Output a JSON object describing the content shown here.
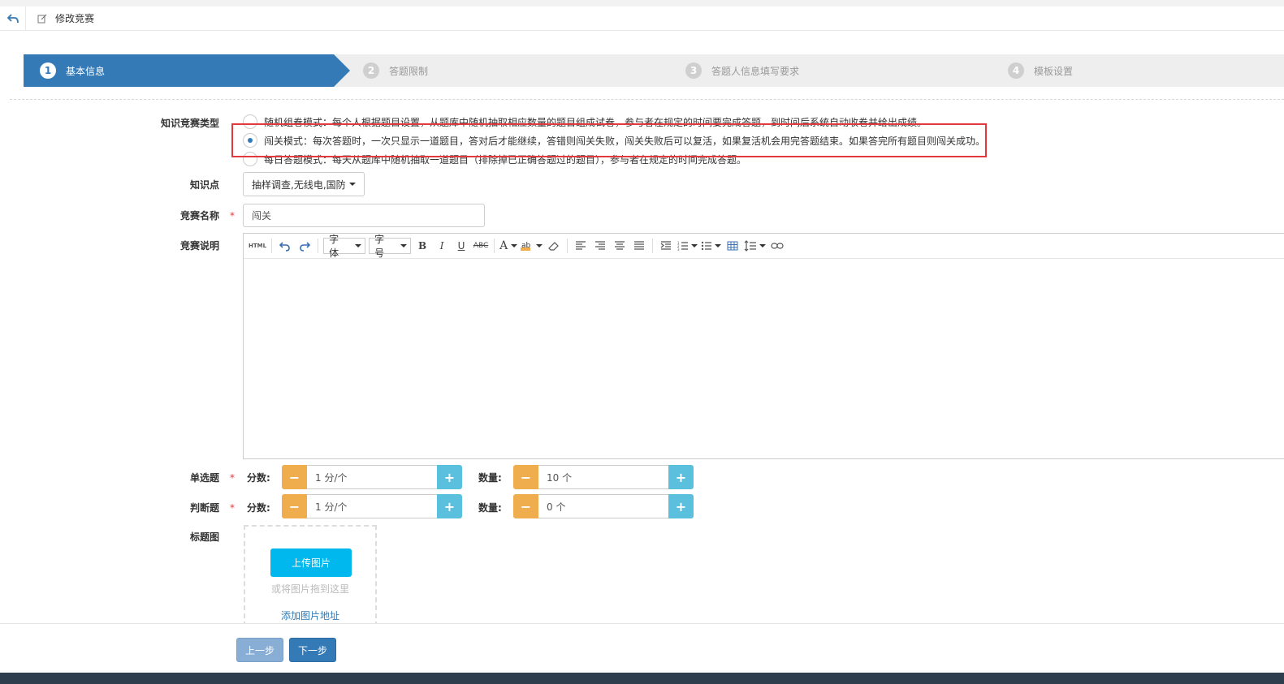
{
  "header": {
    "title": "修改竞赛"
  },
  "steps": [
    {
      "num": "1",
      "label": "基本信息"
    },
    {
      "num": "2",
      "label": "答题限制"
    },
    {
      "num": "3",
      "label": "答题人信息填写要求"
    },
    {
      "num": "4",
      "label": "模板设置"
    }
  ],
  "form": {
    "type_label": "知识竞赛类型",
    "type_options": [
      "随机组卷模式：每个人根据题目设置，从题库中随机抽取相应数量的题目组成试卷，参与者在规定的时间要完成答题，到时间后系统自动收卷并给出成绩。",
      "闯关模式：每次答题时，一次只显示一道题目，答对后才能继续，答错则闯关失败，闯关失败后可以复活，如果复活机会用完答题结束。如果答完所有题目则闯关成功。",
      "每日答题模式：每天从题库中随机抽取一道题目（排除掉已正确答题过的题目），参与者在规定的时间完成答题。"
    ],
    "selected_type_index": 1,
    "knowledge_label": "知识点",
    "knowledge_value": "抽样调查,无线电,国防",
    "name_label": "竞赛名称",
    "name_value": "闯关",
    "desc_label": "竞赛说明",
    "toolbar": {
      "html": "HTML",
      "font": "字体",
      "size": "字号"
    },
    "single": {
      "label": "单选题",
      "score_label": "分数:",
      "score_value": "1 分/个",
      "count_label": "数量:",
      "count_value": "10 个"
    },
    "judge": {
      "label": "判断题",
      "score_label": "分数:",
      "score_value": "1 分/个",
      "count_label": "数量:",
      "count_value": "0 个"
    },
    "cover_label": "标题图",
    "upload_button": "上传图片",
    "upload_hint": "或将图片拖到这里",
    "upload_link": "添加图片地址"
  },
  "footer": {
    "prev": "上一步",
    "next": "下一步"
  },
  "colors": {
    "primary": "#337ab7",
    "minus": "#f0ad4e",
    "plus": "#5bc0de",
    "upload": "#00b7ee",
    "highlight": "#e4393c"
  }
}
